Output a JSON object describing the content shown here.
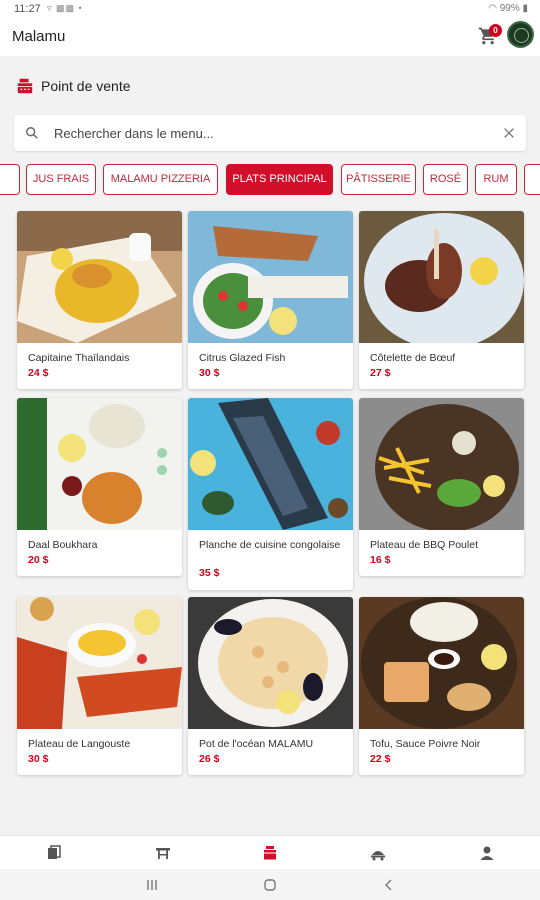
{
  "status_bar": {
    "time": "11:27",
    "indicators": "▿ ▩▩ •",
    "battery": "99%"
  },
  "app_bar": {
    "title": "Malamu",
    "cart_count": "0"
  },
  "section": {
    "title": "Point de vente",
    "icon": "cash-register-icon"
  },
  "search": {
    "placeholder": "Rechercher dans le menu..."
  },
  "categories": [
    {
      "label": ""
    },
    {
      "label": "JUS FRAIS"
    },
    {
      "label": "MALAMU PIZZERIA"
    },
    {
      "label": "PLATS PRINCIPAL",
      "active": true
    },
    {
      "label": "PÂTISSERIE"
    },
    {
      "label": "ROSÉ"
    },
    {
      "label": "RUM"
    },
    {
      "label": ""
    }
  ],
  "products": [
    {
      "name": "Capitaine Thaïlandais",
      "price": "24 $"
    },
    {
      "name": "Citrus Glazed Fish",
      "price": "30 $"
    },
    {
      "name": "Côtelette de Bœuf",
      "price": "27 $"
    },
    {
      "name": "Daal Boukhara",
      "price": "20 $"
    },
    {
      "name": "Planche de cuisine congolaise",
      "price": "35 $"
    },
    {
      "name": "Plateau de BBQ Poulet",
      "price": "16 $"
    },
    {
      "name": "Plateau de Langouste",
      "price": "30 $"
    },
    {
      "name": "Pot de l'océan MALAMU",
      "price": "26 $"
    },
    {
      "name": "Tofu, Sauce Poivre Noir",
      "price": "22 $"
    }
  ],
  "colors": {
    "accent": "#d20f2a",
    "price": "#d0021b"
  },
  "bottom_nav": [
    {
      "icon": "menu-book-icon"
    },
    {
      "icon": "table-icon"
    },
    {
      "icon": "cash-register-icon",
      "active": true
    },
    {
      "icon": "delivery-icon"
    },
    {
      "icon": "person-icon"
    }
  ]
}
